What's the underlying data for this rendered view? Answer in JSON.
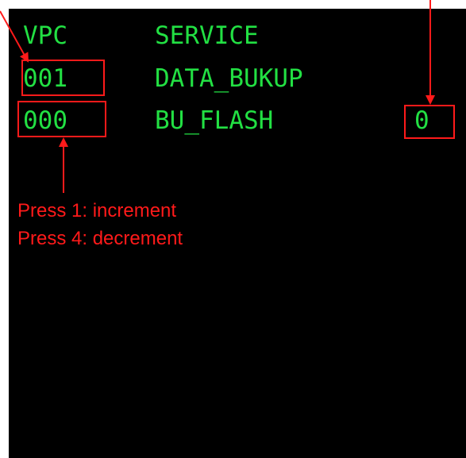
{
  "screen": {
    "header": {
      "col_vpc": "VPC",
      "col_service": "SERVICE"
    },
    "rows": [
      {
        "vpc": "001",
        "service": "DATA_BUKUP",
        "value": ""
      },
      {
        "vpc": "000",
        "service": "BU_FLASH",
        "value": "0"
      }
    ]
  },
  "annotations": {
    "hint_line_1": "Press 1: increment",
    "hint_line_2": "Press 4: decrement"
  },
  "colors": {
    "terminal_text": "#22e043",
    "annotation": "#ff1a1a",
    "screen_background": "#000000"
  }
}
